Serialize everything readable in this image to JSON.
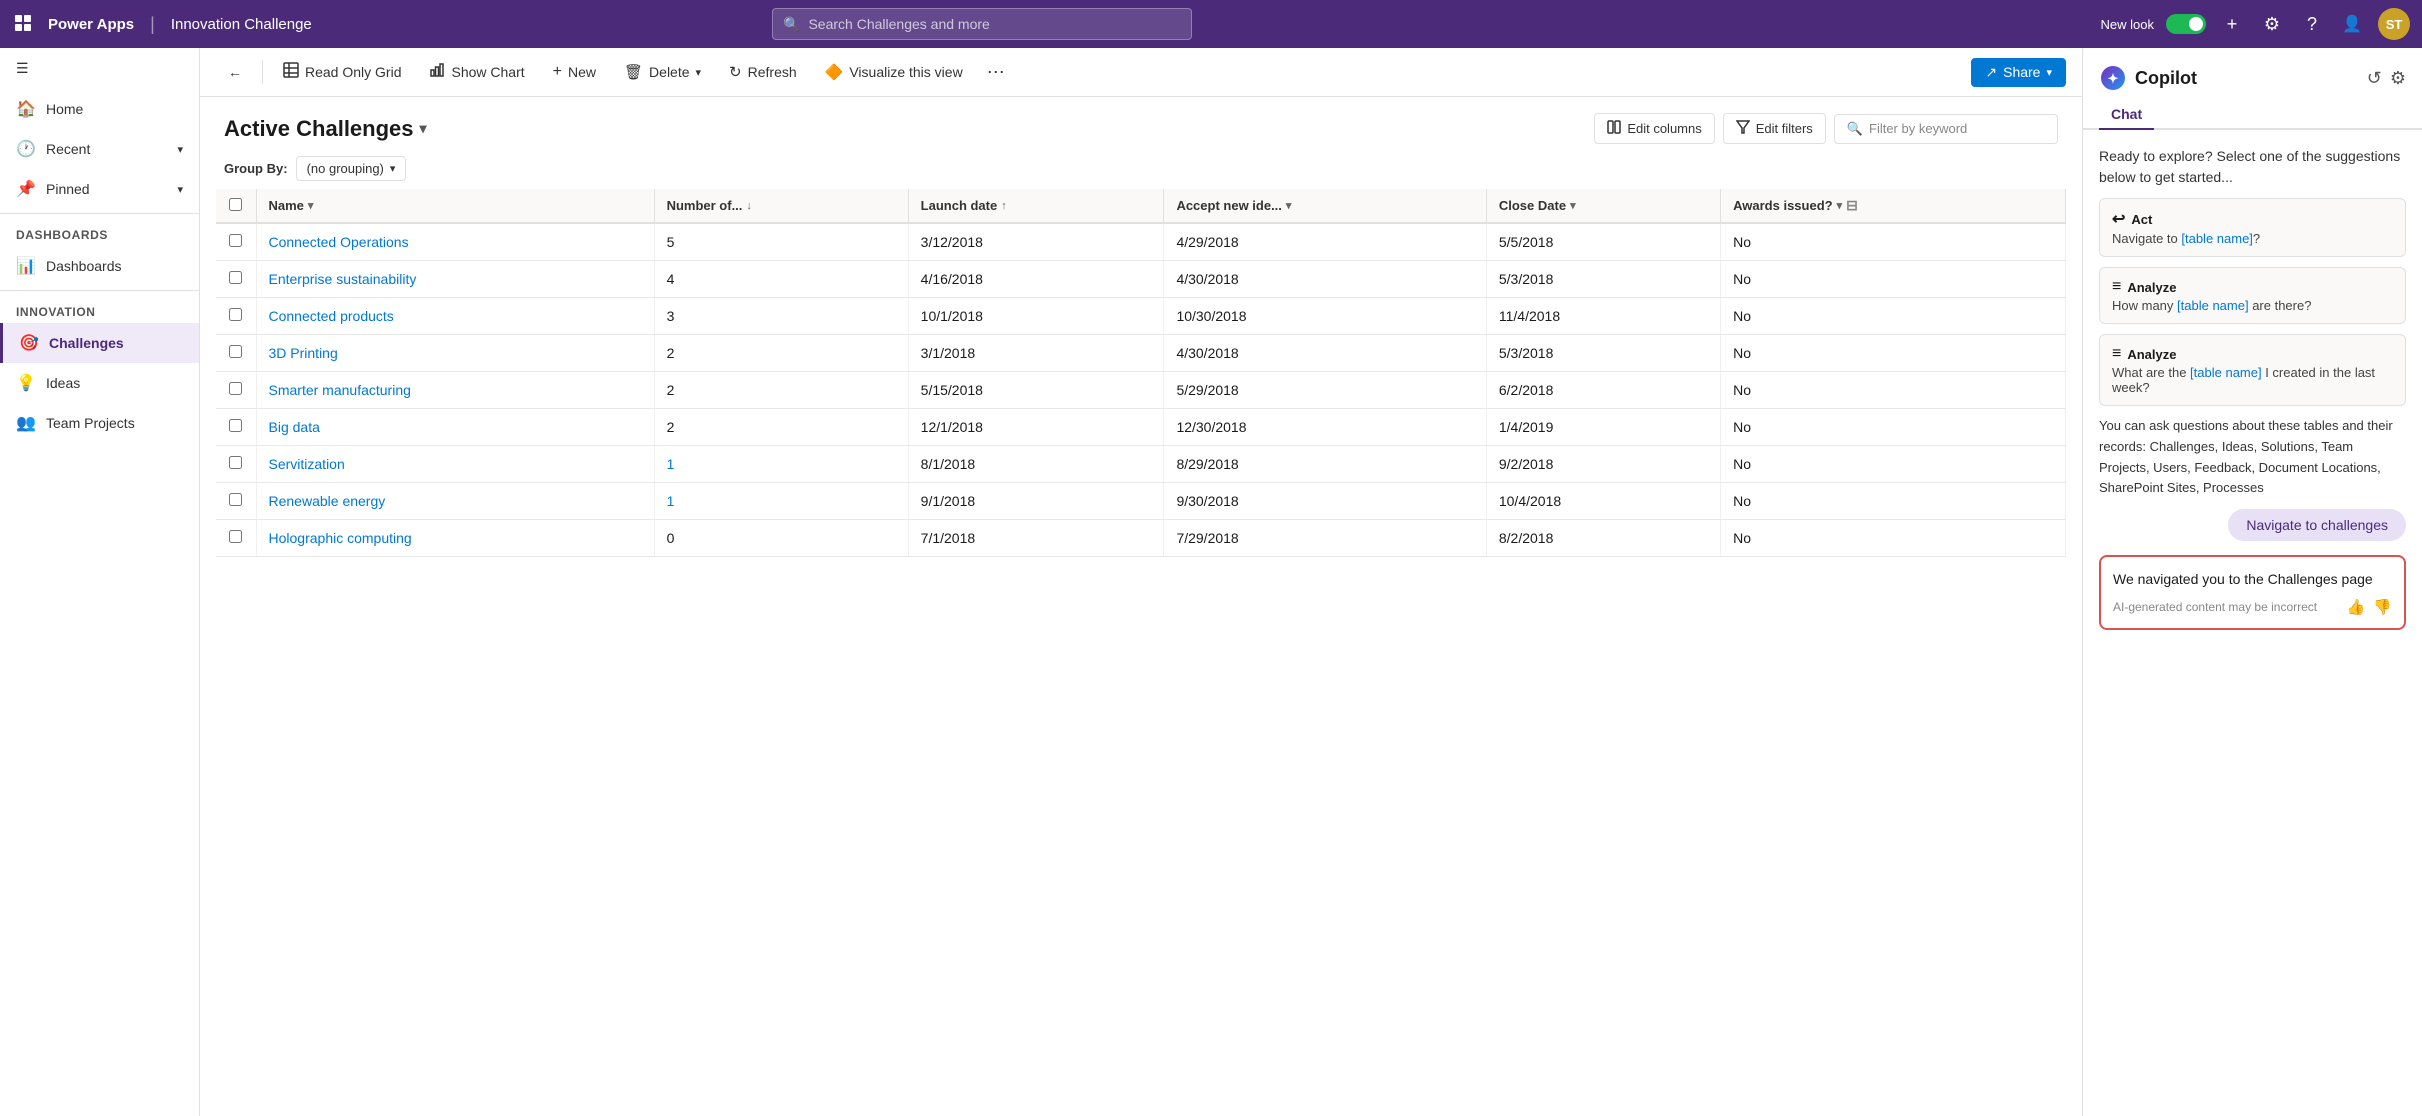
{
  "topnav": {
    "app_grid_icon": "⊞",
    "app_name": "Power Apps",
    "separator": "|",
    "app_title": "Innovation Challenge",
    "search_placeholder": "Search Challenges and more",
    "new_look_label": "New look",
    "plus_icon": "+",
    "settings_icon": "⚙",
    "help_icon": "?",
    "persona_icon": "👤",
    "avatar_text": "ST"
  },
  "sidebar": {
    "hamburger": "☰",
    "items": [
      {
        "id": "home",
        "icon": "🏠",
        "label": "Home",
        "has_chevron": false
      },
      {
        "id": "recent",
        "icon": "🕐",
        "label": "Recent",
        "has_chevron": true
      },
      {
        "id": "pinned",
        "icon": "📌",
        "label": "Pinned",
        "has_chevron": true
      }
    ],
    "section_dashboards": "Dashboards",
    "section_innovation": "Innovation",
    "dashboard_item": {
      "icon": "📊",
      "label": "Dashboards"
    },
    "innovation_items": [
      {
        "id": "challenges",
        "icon": "🎯",
        "label": "Challenges",
        "active": true
      },
      {
        "id": "ideas",
        "icon": "💡",
        "label": "Ideas"
      },
      {
        "id": "team-projects",
        "icon": "👥",
        "label": "Team Projects"
      }
    ]
  },
  "toolbar": {
    "back_icon": "←",
    "read_only_grid_icon": "⊞",
    "read_only_grid_label": "Read Only Grid",
    "show_chart_icon": "📊",
    "show_chart_label": "Show Chart",
    "new_icon": "+",
    "new_label": "New",
    "delete_icon": "🗑",
    "delete_label": "Delete",
    "dropdown_icon": "▾",
    "refresh_icon": "↻",
    "refresh_label": "Refresh",
    "visualize_icon": "🔶",
    "visualize_label": "Visualize this view",
    "more_icon": "⋯",
    "share_icon": "↗",
    "share_label": "Share",
    "share_chevron": "▾"
  },
  "view": {
    "title": "Active Challenges",
    "title_chevron": "▾",
    "edit_columns_icon": "⊞",
    "edit_columns_label": "Edit columns",
    "edit_filters_icon": "⚙",
    "edit_filters_label": "Edit filters",
    "filter_placeholder": "Filter by keyword",
    "group_by_label": "Group By:",
    "group_by_value": "(no grouping)",
    "group_by_chevron": "▾"
  },
  "grid": {
    "columns": [
      {
        "id": "name",
        "label": "Name",
        "sort": "▾",
        "sort_dir": "asc"
      },
      {
        "id": "number",
        "label": "Number of...",
        "sort": "↓",
        "sort_dir": "desc"
      },
      {
        "id": "launch_date",
        "label": "Launch date",
        "sort": "↑",
        "sort_dir": "asc"
      },
      {
        "id": "accept_new",
        "label": "Accept new ide...",
        "sort": "▾",
        "sort_dir": "none"
      },
      {
        "id": "close_date",
        "label": "Close Date",
        "sort": "▾",
        "sort_dir": "none"
      },
      {
        "id": "awards",
        "label": "Awards issued?",
        "sort": "▾",
        "sort_dir": "none"
      }
    ],
    "rows": [
      {
        "name": "Connected Operations",
        "number": "5",
        "number_link": false,
        "launch_date": "3/12/2018",
        "accept_new": "4/29/2018",
        "close_date": "5/5/2018",
        "awards": "No"
      },
      {
        "name": "Enterprise sustainability",
        "number": "4",
        "number_link": false,
        "launch_date": "4/16/2018",
        "accept_new": "4/30/2018",
        "close_date": "5/3/2018",
        "awards": "No"
      },
      {
        "name": "Connected products",
        "number": "3",
        "number_link": false,
        "launch_date": "10/1/2018",
        "accept_new": "10/30/2018",
        "close_date": "11/4/2018",
        "awards": "No"
      },
      {
        "name": "3D Printing",
        "number": "2",
        "number_link": false,
        "launch_date": "3/1/2018",
        "accept_new": "4/30/2018",
        "close_date": "5/3/2018",
        "awards": "No"
      },
      {
        "name": "Smarter manufacturing",
        "number": "2",
        "number_link": false,
        "launch_date": "5/15/2018",
        "accept_new": "5/29/2018",
        "close_date": "6/2/2018",
        "awards": "No"
      },
      {
        "name": "Big data",
        "number": "2",
        "number_link": false,
        "launch_date": "12/1/2018",
        "accept_new": "12/30/2018",
        "close_date": "1/4/2019",
        "awards": "No"
      },
      {
        "name": "Servitization",
        "number": "1",
        "number_link": true,
        "launch_date": "8/1/2018",
        "accept_new": "8/29/2018",
        "close_date": "9/2/2018",
        "awards": "No"
      },
      {
        "name": "Renewable energy",
        "number": "1",
        "number_link": true,
        "launch_date": "9/1/2018",
        "accept_new": "9/30/2018",
        "close_date": "10/4/2018",
        "awards": "No"
      },
      {
        "name": "Holographic computing",
        "number": "0",
        "number_link": false,
        "launch_date": "7/1/2018",
        "accept_new": "7/29/2018",
        "close_date": "8/2/2018",
        "awards": "No"
      }
    ]
  },
  "copilot": {
    "logo_text": "🟣",
    "title": "Copilot",
    "refresh_icon": "↺",
    "settings_icon": "⚙",
    "tab_chat": "Chat",
    "intro_text": "Ready to explore? Select one of the suggestions below to get started...",
    "suggestions": [
      {
        "icon": "↩",
        "title": "Act",
        "desc_prefix": "Navigate to ",
        "desc_link": "[table name]",
        "desc_suffix": "?"
      },
      {
        "icon": "≡",
        "title": "Analyze",
        "desc_prefix": "How many ",
        "desc_link": "[table name]",
        "desc_suffix": " are there?"
      },
      {
        "icon": "≡",
        "title": "Analyze",
        "desc_prefix": "What are the ",
        "desc_link": "[table name]",
        "desc_suffix": " I created in the last week?"
      }
    ],
    "tables_text": "You can ask questions about these tables and their records: Challenges, Ideas, Solutions, Team Projects, Users, Feedback, Document Locations, SharePoint Sites, Processes",
    "navigate_btn_label": "Navigate to challenges",
    "response_text": "We navigated you to the Challenges page",
    "response_disclaimer": "AI-generated content may be incorrect",
    "thumbup_icon": "👍",
    "thumbdown_icon": "👎"
  }
}
